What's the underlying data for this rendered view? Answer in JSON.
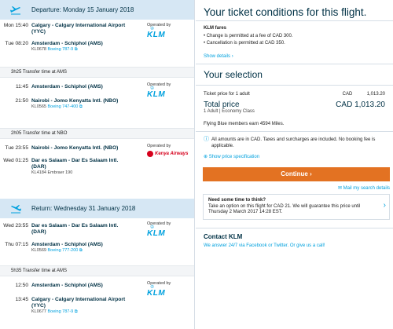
{
  "outbound": {
    "header": "Departure: Monday 15 January 2018",
    "segments": [
      {
        "dep_time": "Mon 15:40",
        "dep_place": "Calgary - Calgary International Airport (YYC)",
        "arr_time": "Tue 08:20",
        "arr_place": "Amsterdam - Schiphol (AMS)",
        "flight": "KL0678",
        "aircraft": "Boeing 787-9",
        "operated_by": "Operated by",
        "airline": "KLM"
      },
      {
        "dep_time": "11:45",
        "dep_place": "Amsterdam - Schiphol (AMS)",
        "arr_time": "21:50",
        "arr_place": "Nairobi - Jomo Kenyatta Intl. (NBO)",
        "flight": "KL0565",
        "aircraft": "Boeing 747-400",
        "operated_by": "Operated by",
        "airline": "KLM"
      },
      {
        "dep_time": "Tue 23:55",
        "dep_place": "Nairobi - Jomo Kenyatta Intl. (NBO)",
        "arr_time": "Wed 01:25",
        "arr_place": "Dar es Salaam - Dar Es Salaam Intl. (DAR)",
        "flight": "KL4184",
        "aircraft": "Embraer 190",
        "operated_by": "Operated by",
        "airline": "Kenya Airways"
      }
    ],
    "transfers": [
      "3h25 Transfer time at AMS",
      "2h05 Transfer time at NBO"
    ]
  },
  "return": {
    "header": "Return: Wednesday 31 January 2018",
    "segments": [
      {
        "dep_time": "Wed 23:55",
        "dep_place": "Dar es Salaam - Dar Es Salaam Intl. (DAR)",
        "arr_time": "Thu 07:15",
        "arr_place": "Amsterdam - Schiphol (AMS)",
        "flight": "KL0569",
        "aircraft": "Boeing 777-200",
        "operated_by": "Operated by",
        "airline": "KLM"
      },
      {
        "dep_time": "12:50",
        "dep_place": "Amsterdam - Schiphol (AMS)",
        "arr_time": "13:45",
        "arr_place": "Calgary - Calgary International Airport (YYC)",
        "flight": "KL0677",
        "aircraft": "Boeing 787-9",
        "operated_by": "Operated by",
        "airline": "KLM"
      }
    ],
    "transfers": [
      "5h35 Transfer time at AMS"
    ]
  },
  "conditions": {
    "title": "Your ticket conditions for this flight.",
    "fares_label": "KLM fares",
    "items": [
      "Change is permitted at a fee of CAD 300.",
      "Cancellation is permitted at CAD 350."
    ],
    "show_details": "Show details"
  },
  "selection": {
    "title": "Your selection",
    "ticket_label": "Ticket price for 1 adult",
    "ticket_currency": "CAD",
    "ticket_amount": "1,013.20",
    "total_label": "Total price",
    "total_value": "CAD 1,013.20",
    "total_sub": "1 Adult | Economy Class",
    "miles": "Flying Blue members earn 4594 Miles.",
    "info": "All amounts are in CAD. Taxes and surcharges are included. No booking fee is applicable.",
    "show_price_spec": "Show price specification",
    "continue": "Continue",
    "mail": "Mail my search details",
    "think_title": "Need some time to think?",
    "think_text": "Take an option on this flight for CAD 21. We will guarantee this price until Thursday 2 March 2017 14:28 EST."
  },
  "contact": {
    "title": "Contact KLM",
    "text": "We answer 24/7 via Facebook or Twitter. Or give us a call!"
  },
  "colors": {
    "accent": "#00a1de",
    "brand_dark": "#003145",
    "cta": "#e37222",
    "header_bg": "#d6e7f4"
  }
}
